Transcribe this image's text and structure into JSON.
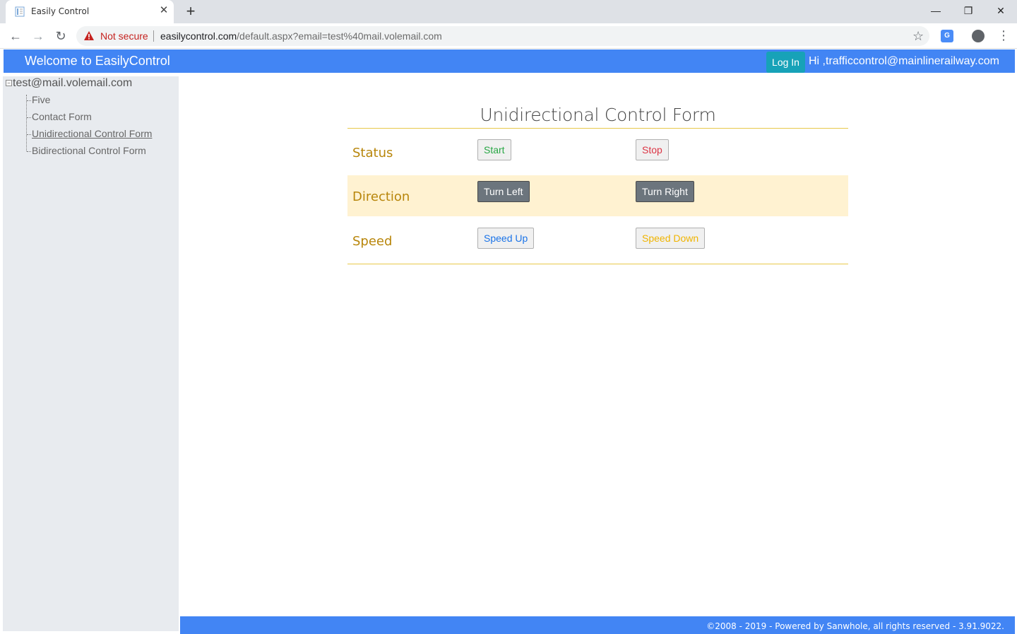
{
  "browser": {
    "tab_title": "Easily Control",
    "close_tab": "✕",
    "new_tab": "+",
    "window_controls": {
      "minimize": "—",
      "maximize": "❐",
      "close": "✕"
    },
    "security_label": "Not secure",
    "url_host": "easilycontrol.com",
    "url_path": "/default.aspx?email=test%40mail.volemail.com"
  },
  "header": {
    "title": "Welcome to EasilyControl",
    "login_label": "Log In",
    "greeting": "Hi ,trafficcontrol@mainlinerailway.com"
  },
  "sidebar": {
    "root": "test@mail.volemail.com",
    "items": [
      {
        "label": "Five"
      },
      {
        "label": "Contact Form"
      },
      {
        "label": "Unidirectional Control Form",
        "active": true
      },
      {
        "label": "Bidirectional Control Form"
      }
    ]
  },
  "form": {
    "title": "Unidirectional Control Form",
    "rows": [
      {
        "label": "Status",
        "left_button": "Start",
        "right_button": "Stop"
      },
      {
        "label": "Direction",
        "left_button": "Turn Left",
        "right_button": "Turn Right"
      },
      {
        "label": "Speed",
        "left_button": "Speed Up",
        "right_button": "Speed Down"
      }
    ]
  },
  "footer": {
    "text": "©2008 - 2019 - Powered by Sanwhole, all rights reserved - 3.91.9022."
  },
  "colors": {
    "brand_blue": "#4285f4",
    "login_teal": "#17a2b8",
    "label_gold": "#b8860b",
    "start_green": "#28a745",
    "stop_red": "#dc3545",
    "speed_up_blue": "#1a73e8",
    "speed_down_amber": "#f0b400"
  }
}
